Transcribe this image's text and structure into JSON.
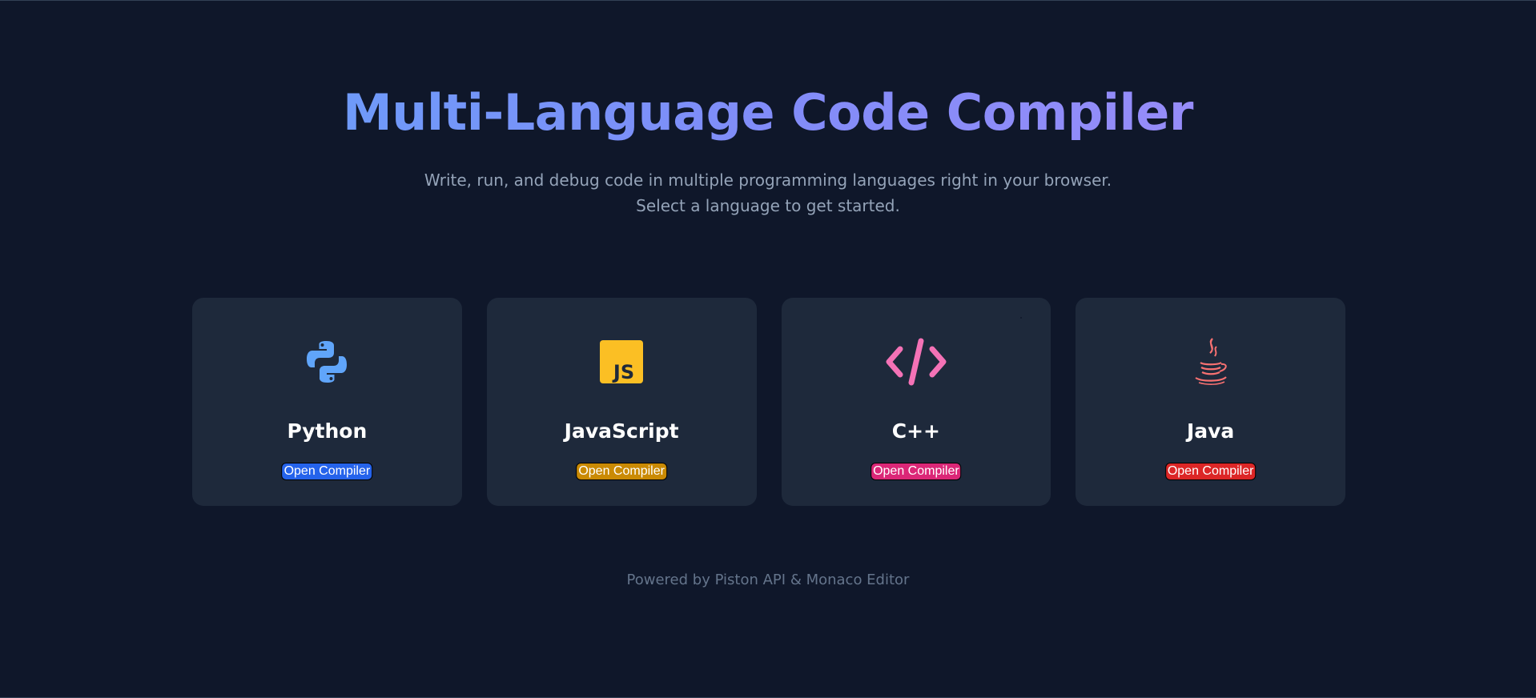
{
  "header": {
    "title": "Multi-Language Code Compiler",
    "subtitle_line1": "Write, run, and debug code in multiple programming languages right in your browser.",
    "subtitle_line2": "Select a language to get started."
  },
  "languages": [
    {
      "name": "Python",
      "button_label": "Open Compiler",
      "icon": "python-icon",
      "button_color": "#2563eb"
    },
    {
      "name": "JavaScript",
      "button_label": "Open Compiler",
      "icon": "javascript-icon",
      "button_color": "#ca8a04"
    },
    {
      "name": "C++",
      "button_label": "Open Compiler",
      "icon": "code-brackets-icon",
      "button_color": "#db2777"
    },
    {
      "name": "Java",
      "button_label": "Open Compiler",
      "icon": "coffee-cup-icon",
      "button_color": "#dc2626"
    }
  ],
  "footer": {
    "text": "Powered by Piston API & Monaco Editor"
  },
  "colors": {
    "background": "#0f172a",
    "card": "#1e293b",
    "title_gradient_start": "#60a5fa",
    "title_gradient_end": "#a78bfa"
  }
}
